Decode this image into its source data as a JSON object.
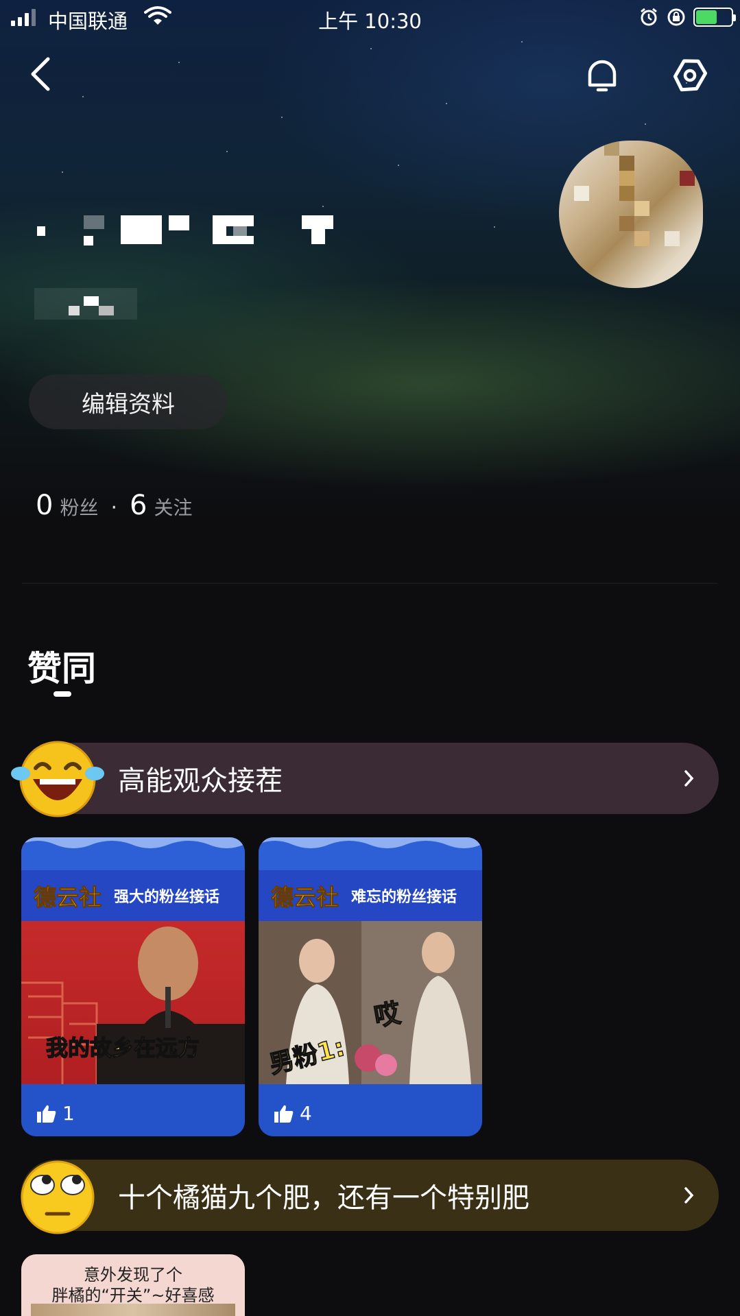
{
  "status_bar": {
    "carrier": "中国联通",
    "time": "上午 10:30"
  },
  "nav": {
    "back_icon": "chevron-left-icon",
    "notification_icon": "bell-icon",
    "settings_icon": "gear-icon"
  },
  "profile": {
    "edit_button_label": "编辑资料",
    "followers_count": "0",
    "followers_label": "粉丝",
    "separator": "·",
    "following_count": "6",
    "following_label": "关注"
  },
  "section": {
    "title": "赞同"
  },
  "collections": [
    {
      "title": "高能观众接茬",
      "emoji_icon": "laughing-crying-emoji-icon",
      "row_color": "#3b2b35",
      "cards": [
        {
          "brand": "德云社",
          "headline": "强大的粉丝接话",
          "caption": "我的故乡在远方",
          "likes": "1"
        },
        {
          "brand": "德云社",
          "headline": "难忘的粉丝接话",
          "caption": "男粉1:",
          "caption2": "哎",
          "likes": "4"
        }
      ]
    },
    {
      "title": "十个橘猫九个肥，还有一个特别肥",
      "emoji_icon": "rolling-eyes-emoji-icon",
      "row_color": "#3a3015",
      "cards": [
        {
          "line1": "意外发现了个",
          "line2": "胖橘的“开关”~好喜感"
        }
      ]
    }
  ],
  "colors": {
    "background": "#0d0d0f",
    "card_blue": "#2452c8",
    "brand_yellow": "#f9d51a",
    "battery_green": "#4cd964"
  }
}
